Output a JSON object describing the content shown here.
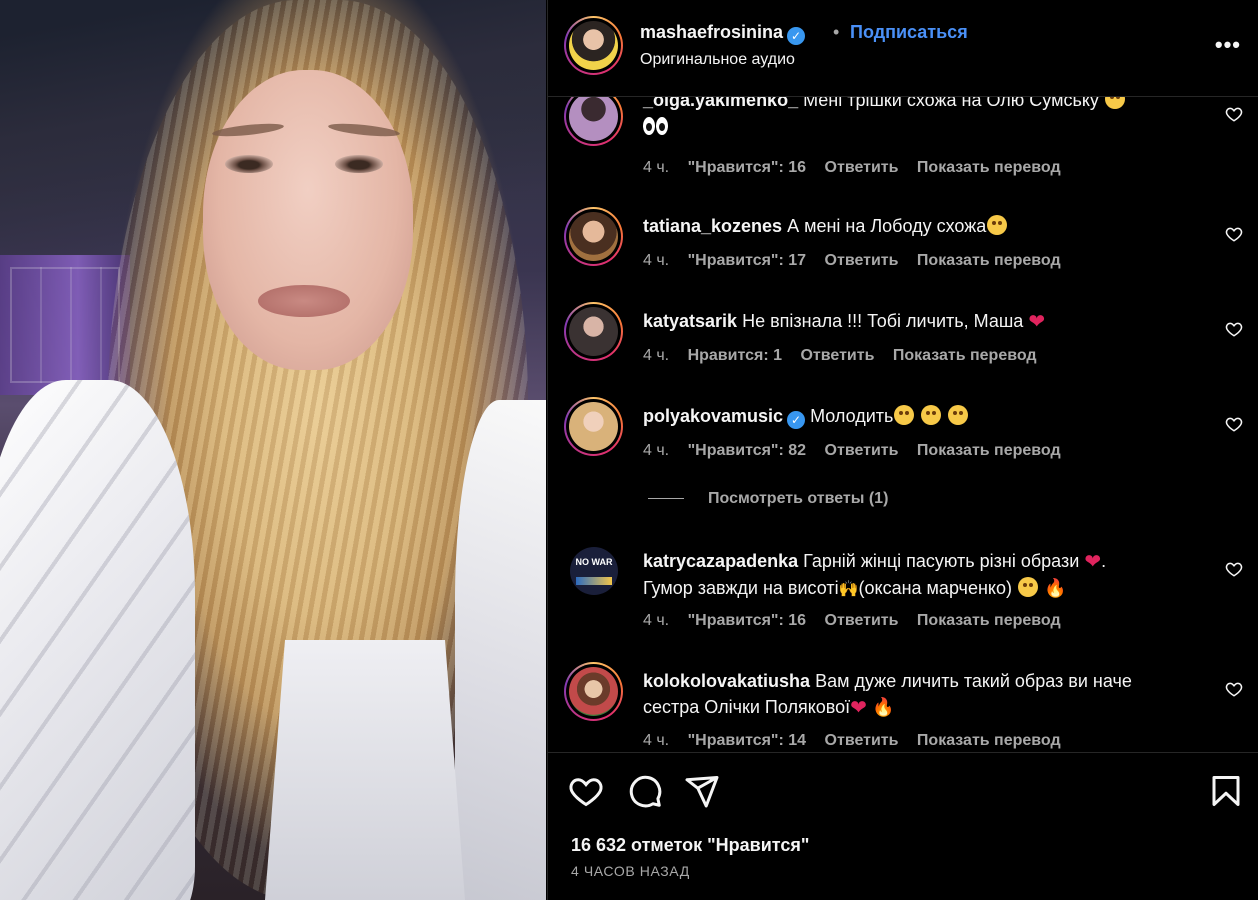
{
  "post": {
    "username": "mashaefrosinina",
    "verified": true,
    "follow_label": "Подписаться",
    "audio_label": "Оригинальное аудио",
    "more_icon": "more-icon"
  },
  "comments": [
    {
      "username": "_olga.yakimenko_",
      "text": "Мені трішки схожа на Олю Сумську",
      "emoji": [
        "star-struck-emoji",
        "eyes-emoji"
      ],
      "time": "4 ч.",
      "likes": "\"Нравится\": 16",
      "reply": "Ответить",
      "translate": "Показать перевод",
      "avatar_color": "#c9a7c9"
    },
    {
      "username": "tatiana_kozenes",
      "text": "А мені на Лободу схожа",
      "emoji": [
        "grin-emoji"
      ],
      "time": "4 ч.",
      "likes": "\"Нравится\": 17",
      "reply": "Ответить",
      "translate": "Показать перевод",
      "avatar_color": "#7a5236"
    },
    {
      "username": "katyatsarik",
      "text": "Не впізнала !!! Тобі личить, Маша",
      "emoji": [
        "heart-emoji"
      ],
      "time": "4 ч.",
      "likes": "Нравится: 1",
      "reply": "Ответить",
      "translate": "Показать перевод",
      "avatar_color": "#5a5050"
    },
    {
      "username": "polyakovamusic",
      "verified": true,
      "text": "Молодить",
      "emoji": [
        "joy-emoji",
        "joy-emoji",
        "joy-emoji"
      ],
      "time": "4 ч.",
      "likes": "\"Нравится\": 82",
      "reply": "Ответить",
      "translate": "Показать перевод",
      "avatar_color": "#d9b27a"
    },
    {
      "username": "katrycazapadenka",
      "text_line1": "Гарній жінці пасують різні образи",
      "text_line2": "Гумор завжди на висоті",
      "text_line2b": "(оксана марченко)",
      "emoji": [
        "heart-emoji",
        "raised-hands-emoji",
        "joy-emoji",
        "fire-emoji"
      ],
      "time": "4 ч.",
      "likes": "\"Нравится\": 16",
      "reply": "Ответить",
      "translate": "Показать перевод",
      "avatar_badge": "NO WAR",
      "avatar_color": "#1a1f3a"
    },
    {
      "username": "kolokolovakatiusha",
      "text_line1": "Вам дуже личить такий образ ви наче",
      "text_line2": "сестра Олічки Полякової",
      "emoji": [
        "heart-emoji",
        "fire-emoji"
      ],
      "time": "4 ч.",
      "likes": "\"Нравится\": 14",
      "reply": "Ответить",
      "translate": "Показать перевод",
      "avatar_color": "#c24a4a"
    }
  ],
  "view_replies": "Посмотреть ответы (1)",
  "actions": {
    "like_icon": "heart-icon",
    "comment_icon": "comment-icon",
    "share_icon": "share-icon",
    "save_icon": "bookmark-icon"
  },
  "likes_total": "16 632 отметок \"Нравится\"",
  "posted_ago": "4 ЧАСОВ НАЗАД",
  "colors": {
    "background": "#000000",
    "text": "#f5f5f5",
    "muted": "#a8a8a8",
    "link": "#4a90f7",
    "heart": "#e0245e"
  }
}
